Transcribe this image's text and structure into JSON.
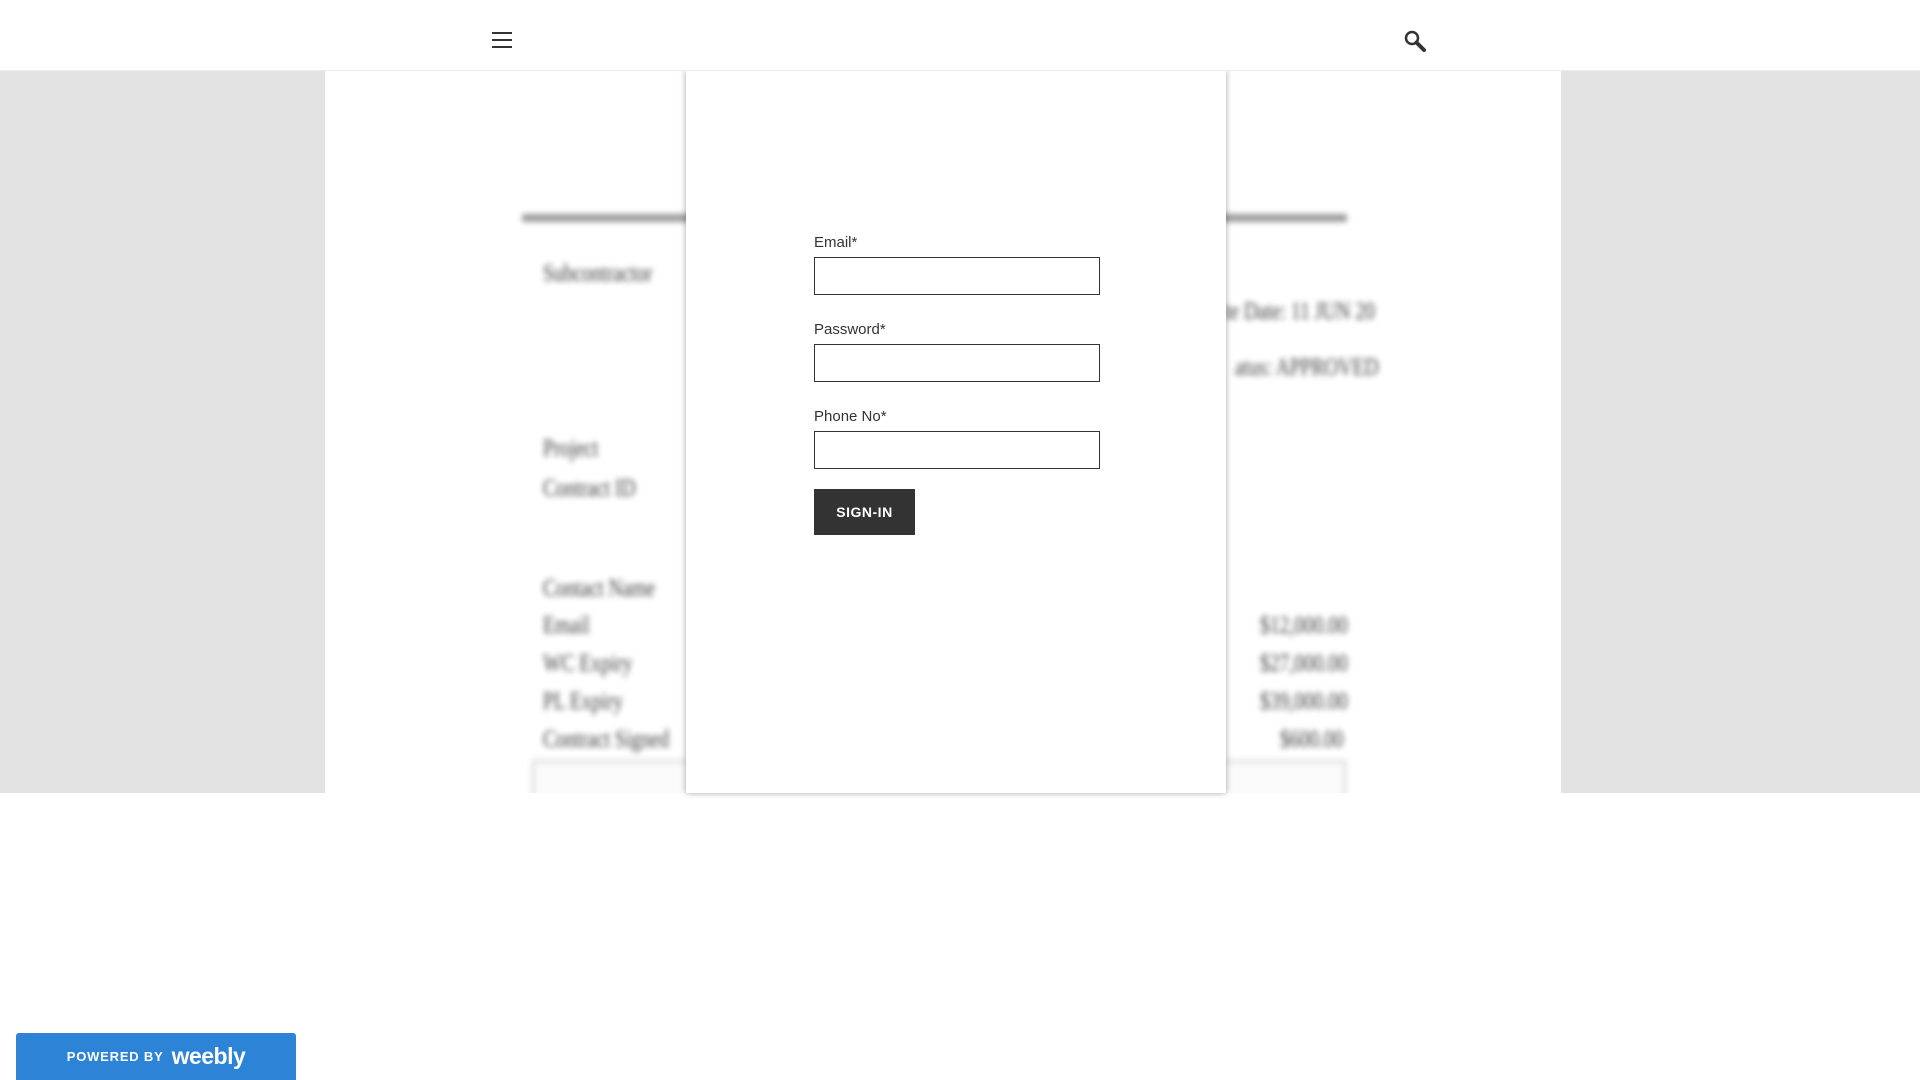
{
  "header": {
    "menu_icon": "hamburger-menu-icon",
    "search_icon": "search-icon"
  },
  "background_document": {
    "left_labels": [
      "Subcontractor",
      "Project",
      "Contract ID",
      "Contact Name",
      "Email",
      "WC Expiry",
      "PL Expiry",
      "Contract Signed"
    ],
    "right_amounts": [
      "$12,000.00",
      "$27,000.00",
      "$39,000.00",
      "$600.00"
    ],
    "right_texts": [
      "te Date: 11 JUN 20",
      "atus: APPROVED"
    ]
  },
  "login_form": {
    "email_label": "Email*",
    "email_value": "",
    "password_label": "Password*",
    "password_value": "",
    "phone_label": "Phone No*",
    "phone_value": "",
    "submit_label": "SIGN-IN"
  },
  "footer": {
    "badge_powered": "POWERED BY",
    "badge_brand": "weebly",
    "badge_color": "#2d83d5"
  },
  "colors": {
    "header_bg": "#ffffff",
    "hero_bg": "#e3e3e3",
    "button_bg": "#333333",
    "button_text": "#ffffff"
  }
}
